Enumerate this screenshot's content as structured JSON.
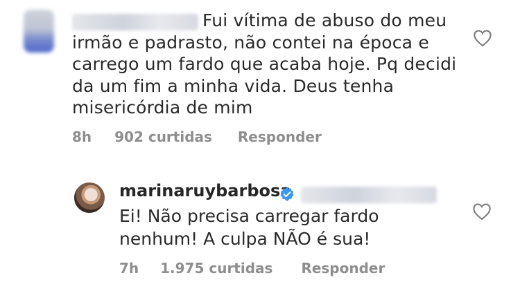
{
  "comments": [
    {
      "avatar": "blurred-avatar",
      "username": "",
      "text": "Fui vítima de abuso do meu\nirmão e padrasto, não contei na época e\ncarrego um fardo que acaba hoje. Pq decidi\nda um fim a minha vida. Deus tenha\nmisericórdia de mim",
      "time": "8h",
      "likes": "902 curtidas",
      "reply_label": "Responder",
      "like_icon": "heart-outline-icon"
    },
    {
      "avatar": "profile-avatar",
      "username": "marinaruybarbosa",
      "verified": true,
      "mention": "",
      "text": "Ei! Não precisa carregar fardo\nnenhum! A culpa NÃO é sua!",
      "time": "7h",
      "likes": "1.975 curtidas",
      "reply_label": "Responder",
      "like_icon": "heart-outline-icon"
    }
  ],
  "colors": {
    "text": "#262626",
    "meta": "#8e8e8e",
    "verified": "#3897f0"
  }
}
